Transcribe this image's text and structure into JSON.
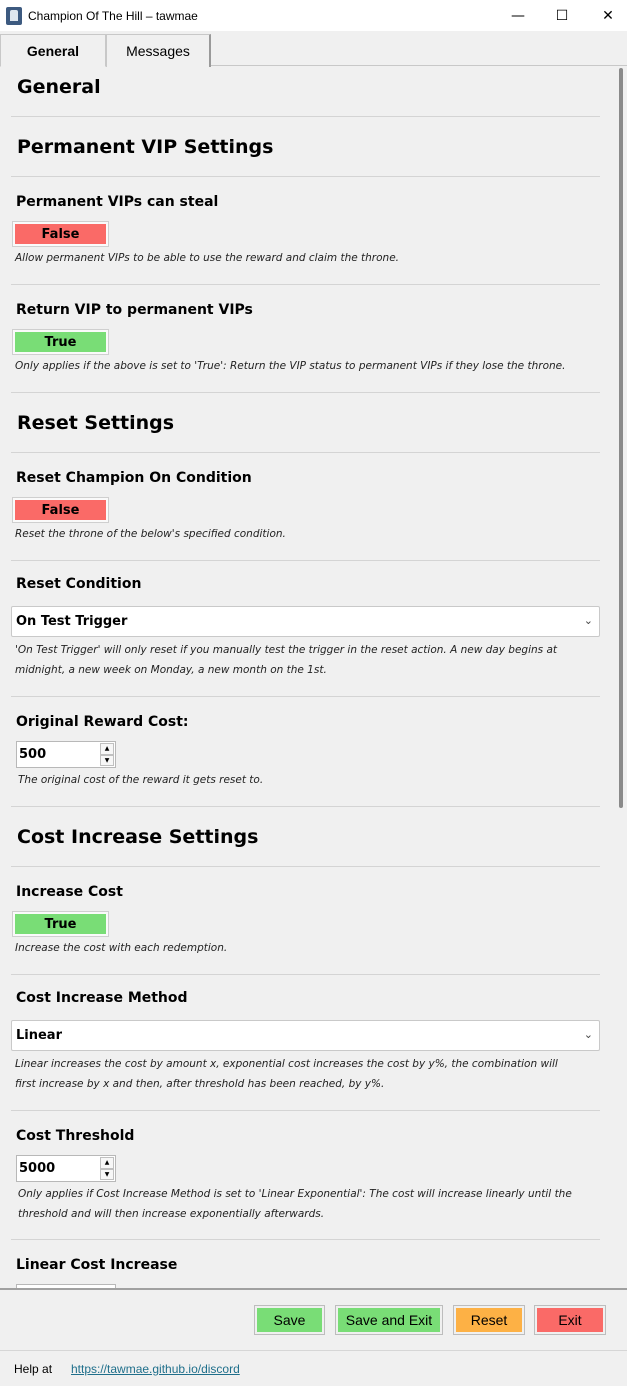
{
  "window": {
    "title": "Champion Of The Hill – tawmae",
    "minimize_glyph": "—",
    "maximize_glyph": "☐",
    "close_glyph": "✕"
  },
  "tabs": [
    {
      "label": "General",
      "active": true
    },
    {
      "label": "Messages",
      "active": false
    }
  ],
  "general": {
    "heading": "General",
    "permanent_vip": {
      "heading": "Permanent VIP Settings",
      "can_steal": {
        "label": "Permanent VIPs can steal",
        "value": "False",
        "description": "Allow permanent VIPs to be able to use the reward and claim the throne."
      },
      "return_vip": {
        "label": "Return VIP to permanent VIPs",
        "value": "True",
        "description": "Only applies if the above is set to 'True': Return the VIP status to permanent VIPs if they lose the throne."
      }
    },
    "reset": {
      "heading": "Reset Settings",
      "reset_on_condition": {
        "label": "Reset Champion On Condition",
        "value": "False",
        "description": "Reset the throne of the below's specified condition."
      },
      "reset_condition": {
        "label": "Reset Condition",
        "value": "On Test Trigger",
        "description_1": "'On Test Trigger' will only reset if you manually test the trigger in the reset action. A new day begins at",
        "description_2": "midnight, a new week on Monday, a new month on the 1st."
      },
      "original_cost": {
        "label": "Original Reward Cost:",
        "value": "500",
        "description": "The original cost of the reward it gets reset to."
      }
    },
    "cost_increase": {
      "heading": "Cost Increase Settings",
      "increase_cost": {
        "label": "Increase Cost",
        "value": "True",
        "description": "Increase the cost with each redemption."
      },
      "method": {
        "label": "Cost Increase Method",
        "value": "Linear",
        "description_1": "Linear increases the cost by amount x, exponential cost increases the cost by y%, the combination will",
        "description_2": "first increase by x and then, after threshold has been reached, by y%."
      },
      "threshold": {
        "label": "Cost Threshold",
        "value": "5000",
        "description_1": "Only applies if Cost Increase Method is set to 'Linear  Exponential': The cost will increase linearly until the",
        "description_2": "threshold and will then increase exponentially afterwards."
      },
      "linear_increase": {
        "label": "Linear Cost Increase"
      }
    }
  },
  "buttons": {
    "save": "Save",
    "save_and_exit": "Save and Exit",
    "reset": "Reset",
    "exit": "Exit"
  },
  "footer": {
    "help_label": "Help at",
    "help_link": "https://tawmae.github.io/discord"
  },
  "colors": {
    "false_red": "#fa6a67",
    "true_green": "#79dd76",
    "reset_orange": "#fdb145",
    "link": "#1f6f8b"
  }
}
